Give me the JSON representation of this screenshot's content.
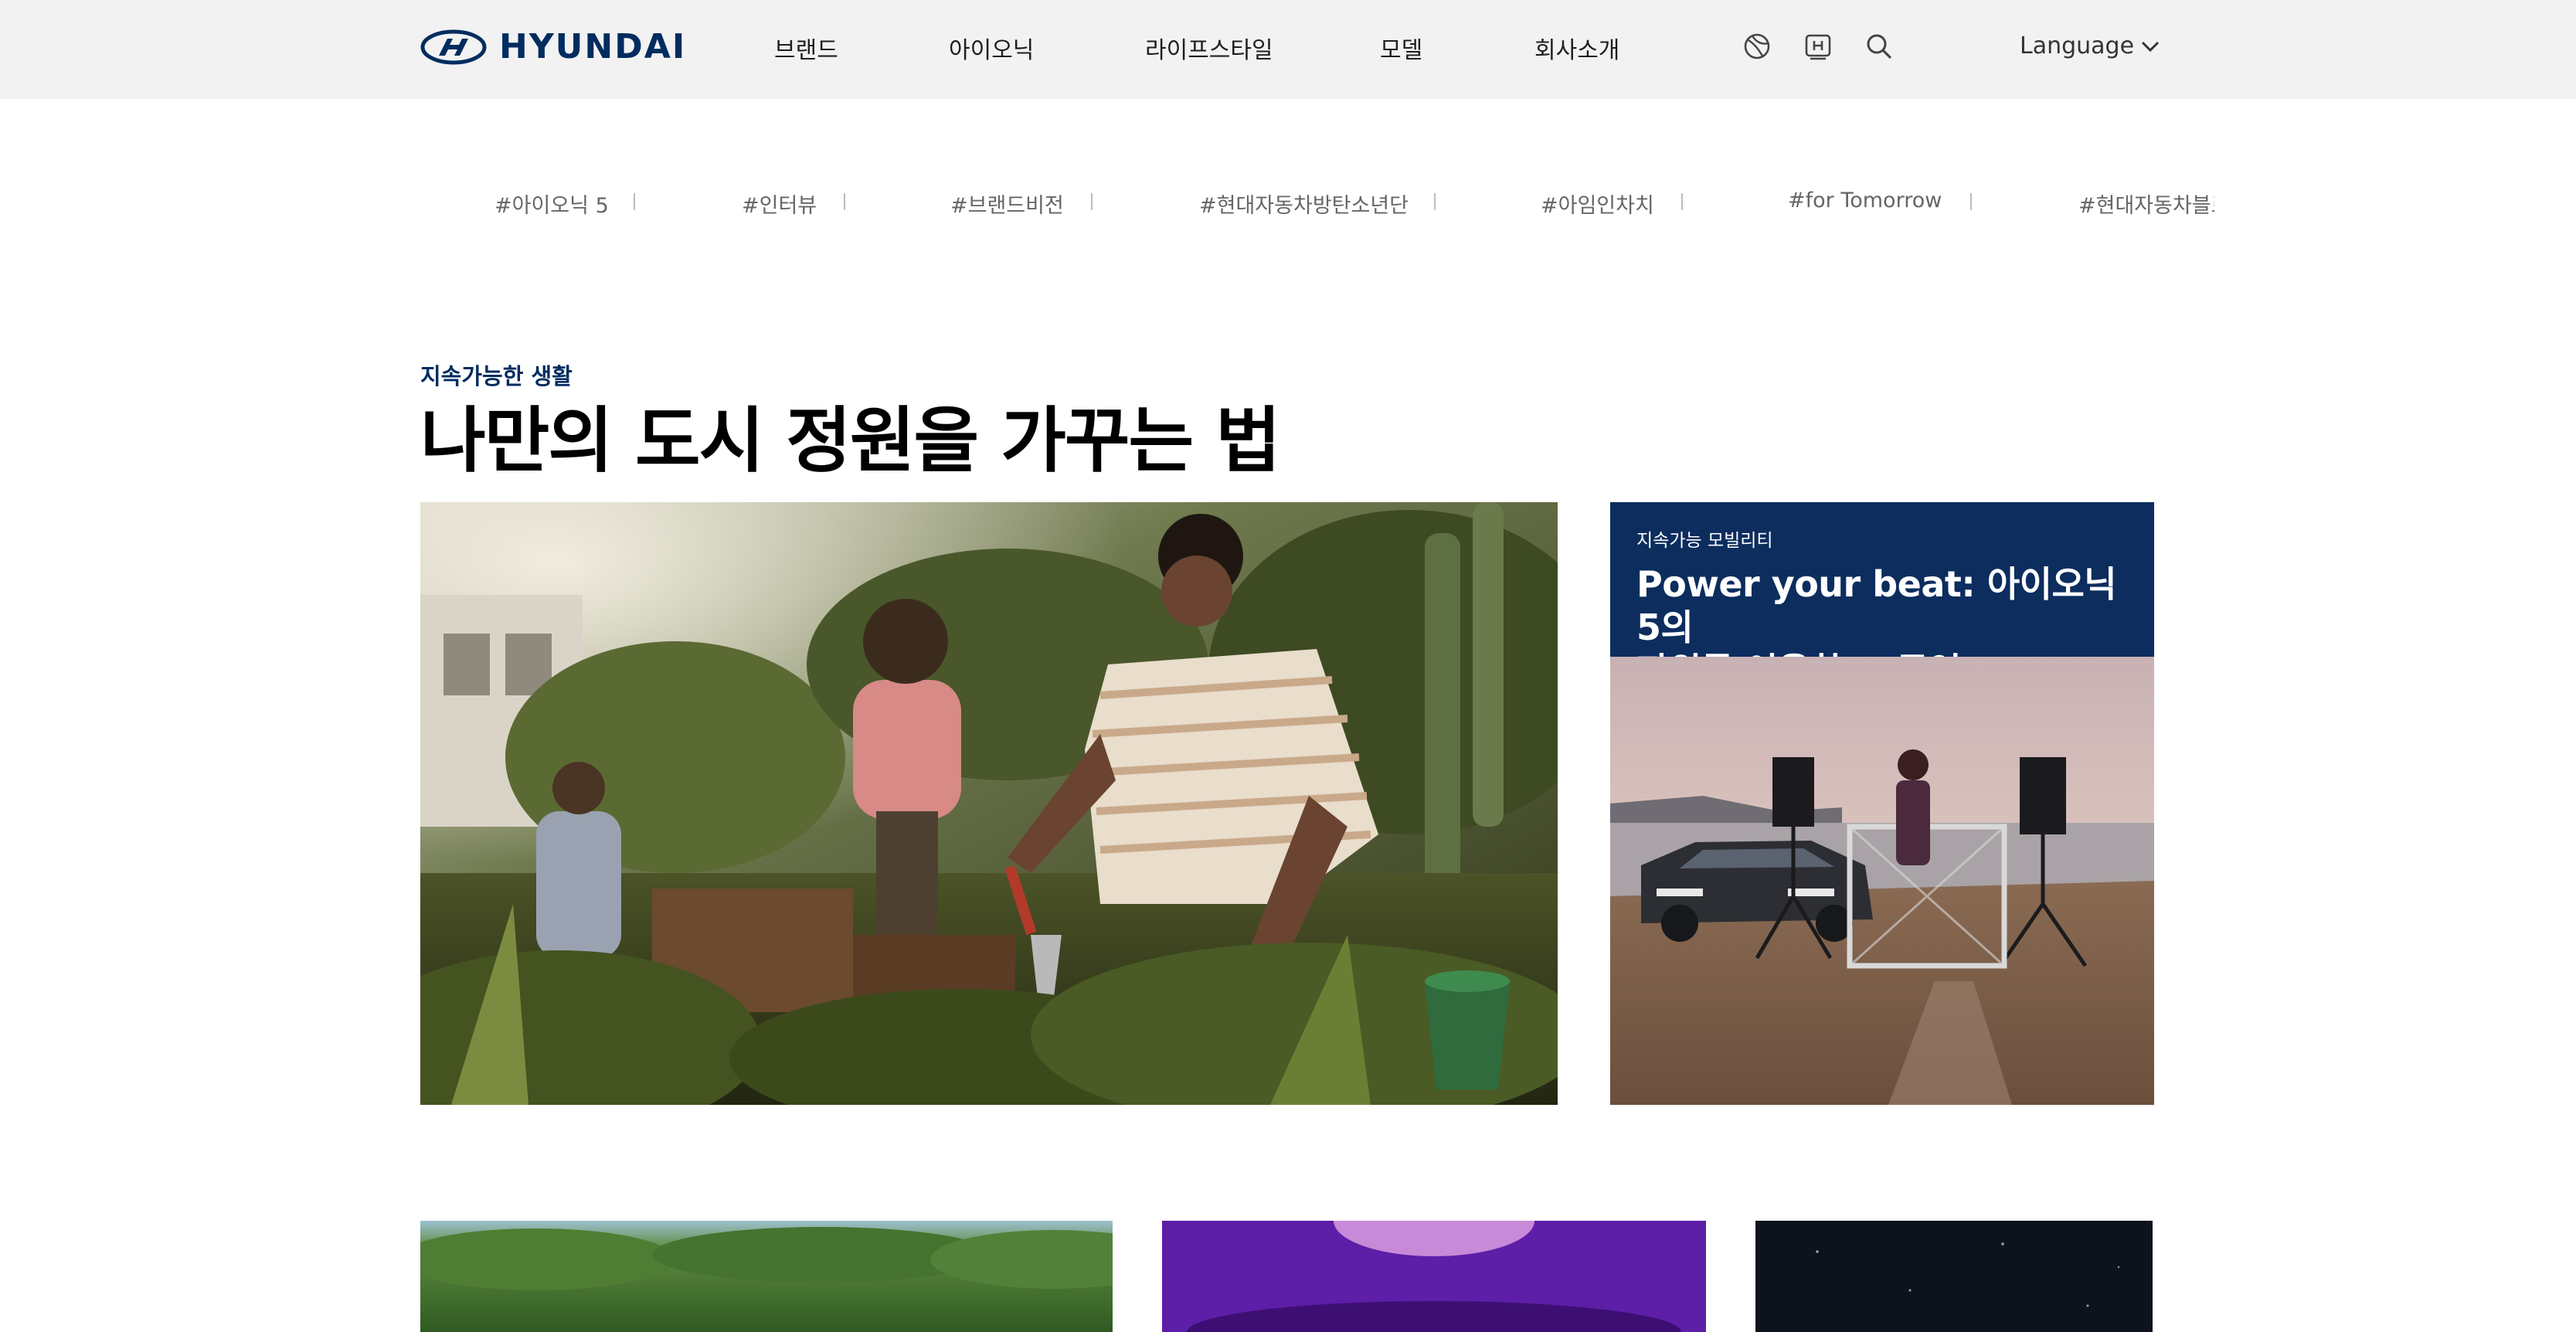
{
  "header": {
    "brand": "HYUNDAI",
    "nav": [
      "브랜드",
      "아이오닉",
      "라이프스타일",
      "모델",
      "회사소개"
    ],
    "icons": [
      "globe-icon",
      "h-badge-icon",
      "search-icon"
    ],
    "language_label": "Language"
  },
  "hashtags": [
    "#아이오닉 5",
    "#인터뷰",
    "#브랜드비전",
    "#현대자동차방탄소년단",
    "#아임인차치",
    "#for Tomorrow",
    "#현대자동차블로그"
  ],
  "featured": {
    "category": "지속가능한 생활",
    "title": "나만의 도시 정원을 가꾸는 법"
  },
  "side_article": {
    "category": "지속가능 모빌리티",
    "title_line1": "Power your beat: 아이오닉 5의",
    "title_line2": "파워를 이용한 DJ공연"
  },
  "colors": {
    "brand_navy": "#002c5f",
    "card_navy": "#0c2d5e",
    "header_bg": "#f2f2f2"
  }
}
